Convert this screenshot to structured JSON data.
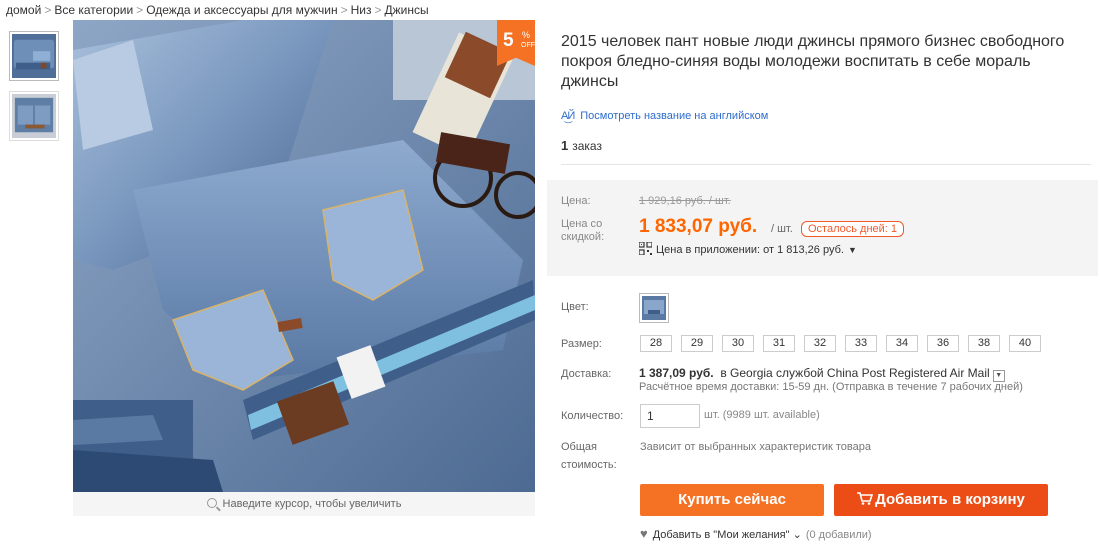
{
  "breadcrumb": [
    "домой",
    "Все категории",
    "Одежда и аксессуары для мужчин",
    "Низ",
    "Джинсы"
  ],
  "breadcrumb_sep": ">",
  "discount": {
    "value": "5",
    "pct": "%",
    "off": "OFF"
  },
  "zoom_hint": "Наведите курсор, чтобы увеличить",
  "product": {
    "title": "2015 человек пант новые люди джинсы прямого бизнес свободного покроя бледно-синяя воды молодежи воспитать в себе мораль джинсы",
    "translate_link": "Посмотреть название на английском",
    "orders_count": "1",
    "orders_label": "заказ"
  },
  "price": {
    "label_price": "Цена:",
    "old": "1 929,16 руб. / шт.",
    "label_discount": "Цена со скидкой:",
    "current": "1 833,07 руб.",
    "per_unit": "/ шт.",
    "days_left": "Осталось дней: 1",
    "app_price": "Цена в приложении: от 1 813,26 руб."
  },
  "options": {
    "color_label": "Цвет:",
    "size_label": "Размер:",
    "sizes": [
      "28",
      "29",
      "30",
      "31",
      "32",
      "33",
      "34",
      "36",
      "38",
      "40"
    ],
    "shipping_label": "Доставка:",
    "shipping_price": "1 387,09 руб.",
    "shipping_text": "в Georgia службой China Post Registered Air Mail",
    "shipping_time": "Расчётное время доставки: 15-59 дн. (Отправка в течение 7 рабочих дней)",
    "qty_label": "Количество:",
    "qty_value": "1",
    "qty_available": "шт. (9989 шт. available)",
    "total_label": "Общая стоимость:",
    "total_note": "Зависит от выбранных характеристик товара"
  },
  "actions": {
    "buy_now": "Купить сейчас",
    "add_to_cart": "Добавить в корзину",
    "wishlist": "Добавить в \"Мои желания\"",
    "wishlist_count": "(0 добавили)"
  },
  "colors": {
    "accent": "#f57224",
    "price": "#ff6600",
    "cart": "#ec4d16",
    "link": "#2d6ccc"
  }
}
